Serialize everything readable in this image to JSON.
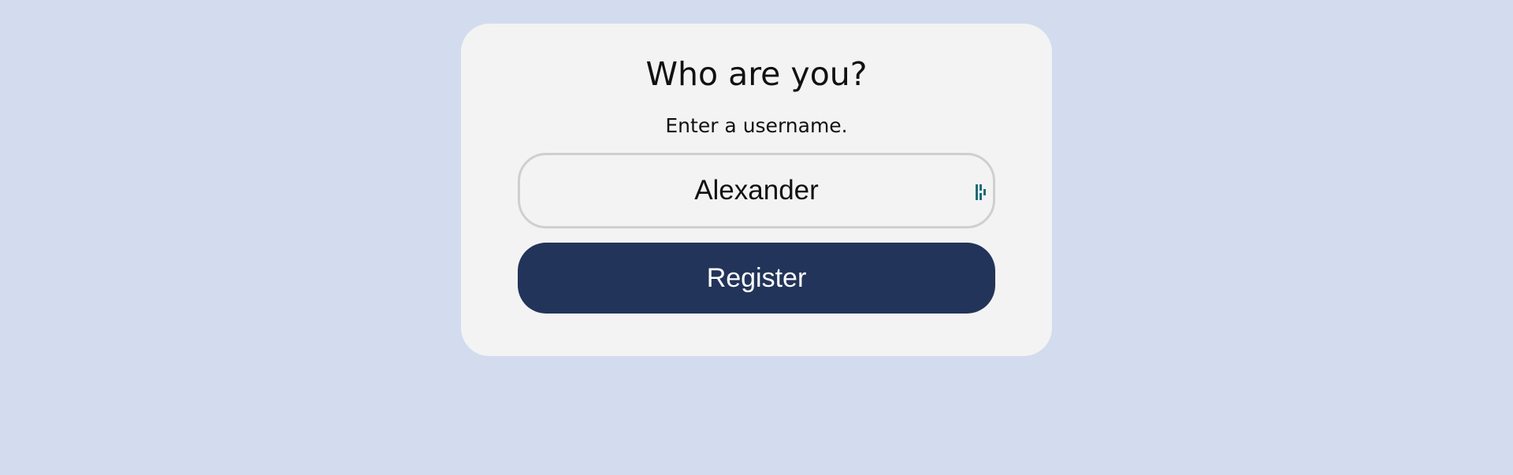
{
  "form": {
    "title": "Who are you?",
    "subtitle": "Enter a username.",
    "username_value": "Alexander",
    "register_label": "Register"
  },
  "colors": {
    "background": "#d3dcee",
    "card": "#f3f3f3",
    "button": "#223459",
    "icon": "#1e6a7a"
  },
  "icons": {
    "input_icon": "password-manager-icon"
  }
}
